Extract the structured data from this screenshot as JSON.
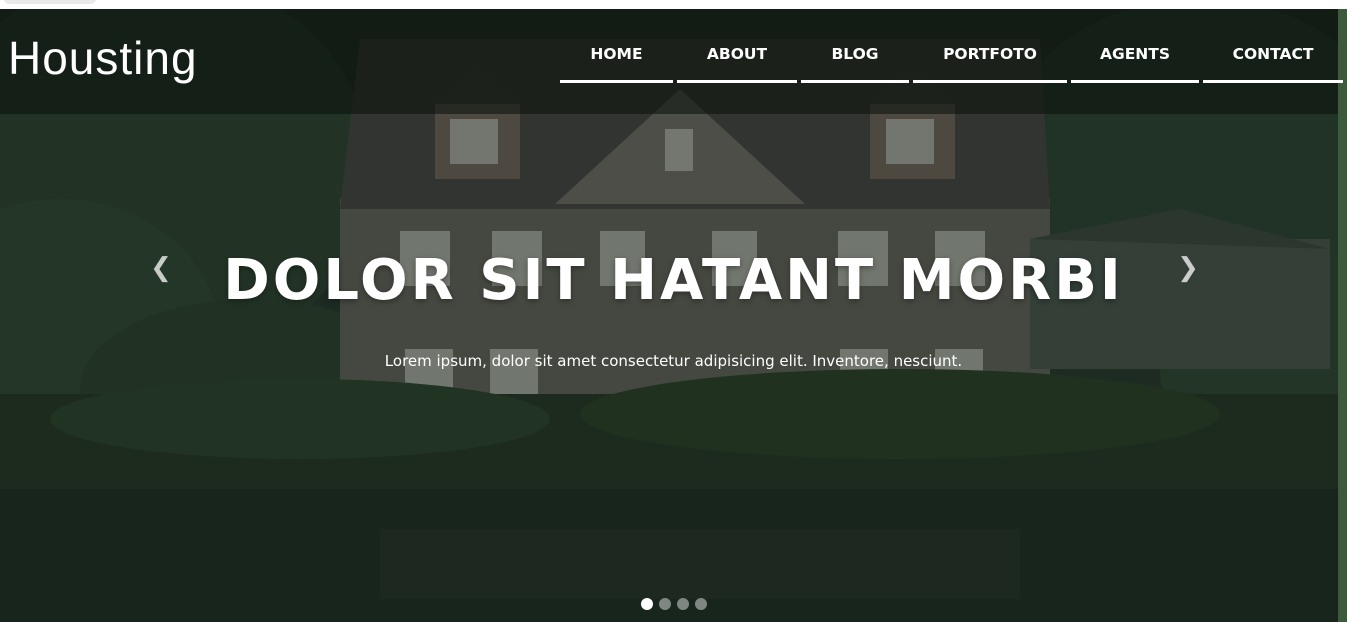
{
  "brand": {
    "logo_text": "Housting"
  },
  "nav": {
    "items": [
      {
        "label": "HOME"
      },
      {
        "label": "ABOUT"
      },
      {
        "label": "BLOG"
      },
      {
        "label": "PORTFOTO"
      },
      {
        "label": "AGENTS"
      },
      {
        "label": "CONTACT"
      }
    ]
  },
  "hero": {
    "title": "DOLOR SIT HATANT MORBI",
    "subtitle": "Lorem ipsum, dolor sit amet consectetur adipisicing elit. Inventore, nesciunt.",
    "prev_icon": "chevron-left-icon",
    "next_icon": "chevron-right-icon",
    "slide_count": 4,
    "active_slide": 1
  },
  "colors": {
    "overlay": "#1b2a1d",
    "text": "#ffffff",
    "accent_edge": "#3e5a3c"
  }
}
